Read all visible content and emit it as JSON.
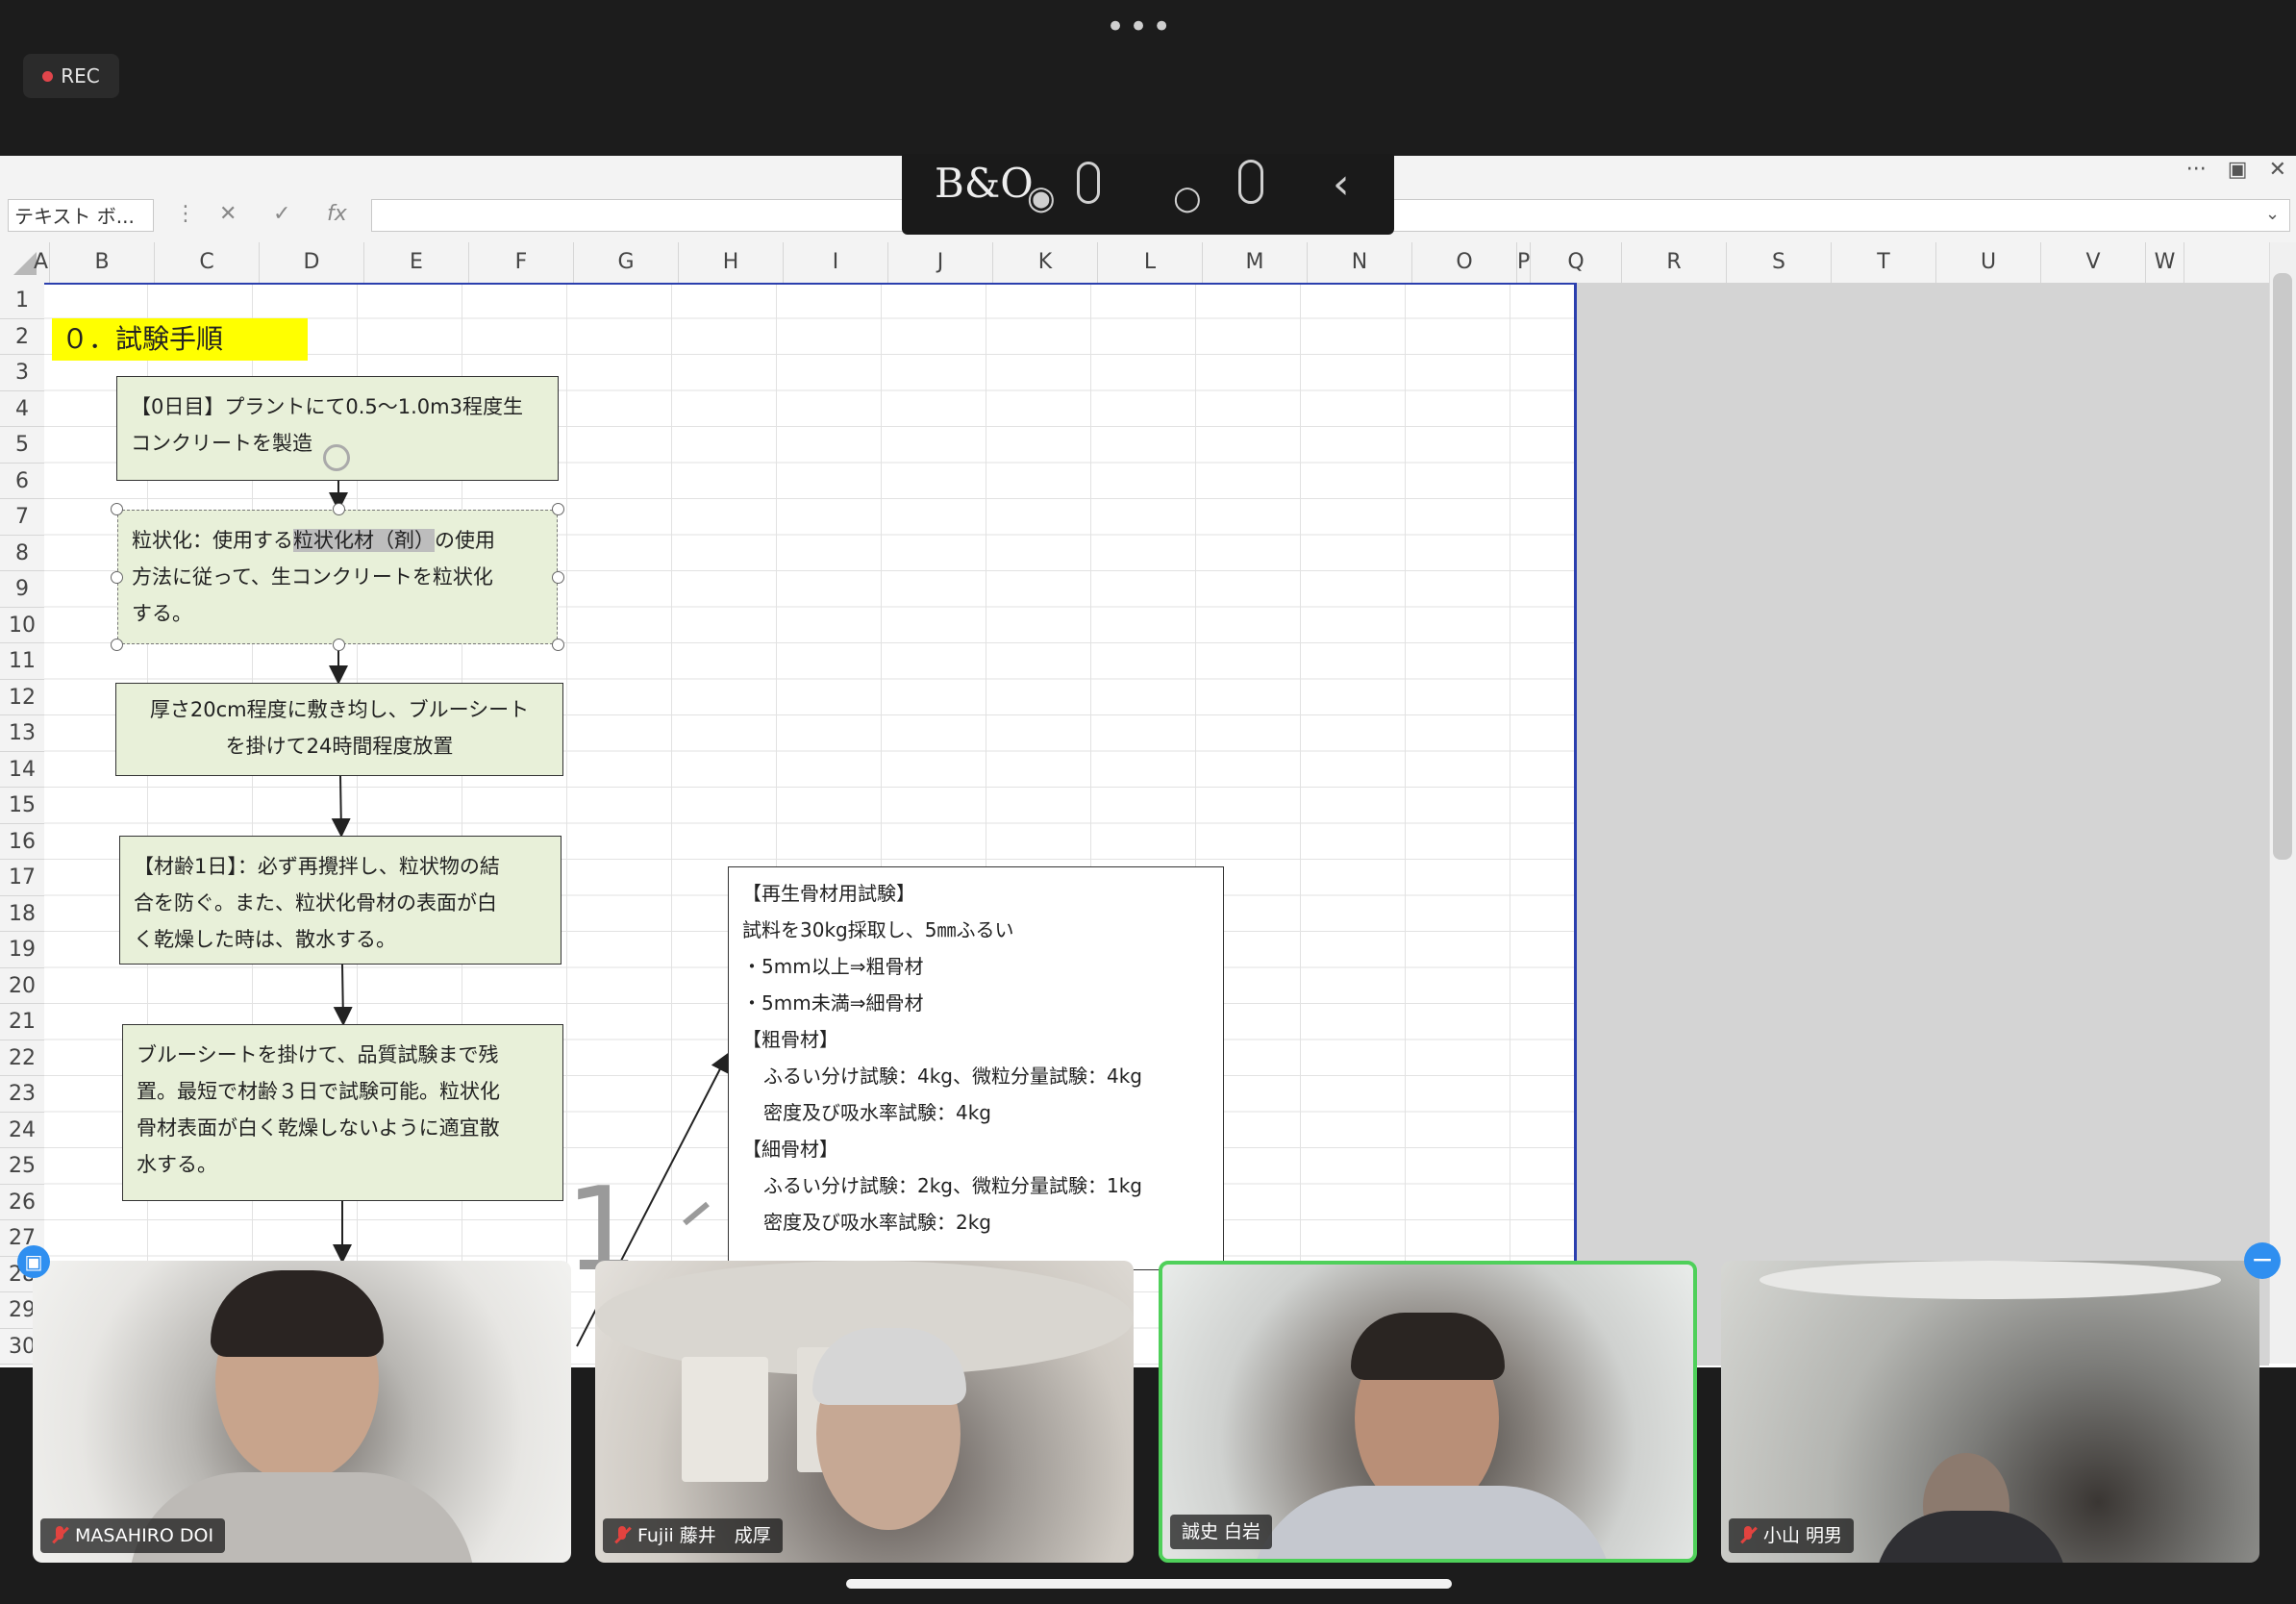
{
  "topbar": {
    "dots": "•••",
    "rec_label": "REC"
  },
  "excel": {
    "window_controls": [
      "···",
      "▣",
      "✕"
    ],
    "name_box": "テキスト ボ...",
    "formula_icons": [
      "✕",
      "✓",
      "fx"
    ],
    "columns": [
      "A",
      "B",
      "C",
      "D",
      "E",
      "F",
      "G",
      "H",
      "I",
      "J",
      "K",
      "L",
      "M",
      "N",
      "O",
      "P",
      "Q",
      "R",
      "S",
      "T",
      "U",
      "V",
      "W"
    ],
    "rows": [
      "1",
      "2",
      "3",
      "4",
      "5",
      "6",
      "7",
      "8",
      "9",
      "10",
      "11",
      "12",
      "13",
      "14",
      "15",
      "16",
      "17",
      "18",
      "19",
      "20",
      "21",
      "22",
      "23",
      "24",
      "25",
      "26",
      "27",
      "28",
      "29",
      "30"
    ]
  },
  "bo_overlay": {
    "logo": "B&O"
  },
  "sheet": {
    "heading": "０．試験手順",
    "box1": [
      "【0日目】プラントにて0.5～1.0m3程度生",
      "コンクリートを製造"
    ],
    "box2": {
      "line1_pre": "粒状化：使用する",
      "line1_hl": "粒状化材（剤）",
      "line1_post": "の使用",
      "line2": "方法に従って、生コンクリートを粒状化",
      "line3": "する。"
    },
    "box3": [
      "厚さ20cm程度に敷き均し、ブルーシート",
      "を掛けて24時間程度放置"
    ],
    "box4": [
      "【材齢1日】：必ず再攪拌し、粒状物の結",
      "合を防ぐ。また、粒状化骨材の表面が白",
      "く乾燥した時は、散水する。"
    ],
    "box5": [
      "ブルーシートを掛けて、品質試験まで残",
      "置。最短で材齢３日で試験可能。粒状化",
      "骨材表面が白く乾燥しないように適宜散",
      "水する。"
    ],
    "info_box": [
      "【再生骨材用試験】",
      "試料を30kg採取し、5㎜ふるい",
      "・5mm以上⇒粗骨材",
      "・5mm未満⇒細骨材",
      "【粗骨材】",
      "ふるい分け試験：4kg、微粒分量試験：4kg",
      "密度及び吸水率試験：4kg",
      "【細骨材】",
      "ふるい分け試験：2kg、微粒分量試験：1kg",
      "密度及び吸水率試験：2kg"
    ],
    "big_digit": "1"
  },
  "participants": [
    {
      "name": "MASAHIRO DOI",
      "muted": true
    },
    {
      "name": "Fujii 藤井　成厚",
      "muted": true
    },
    {
      "name": "誠史 白岩",
      "muted": false
    },
    {
      "name": "小山 明男",
      "muted": true
    }
  ]
}
